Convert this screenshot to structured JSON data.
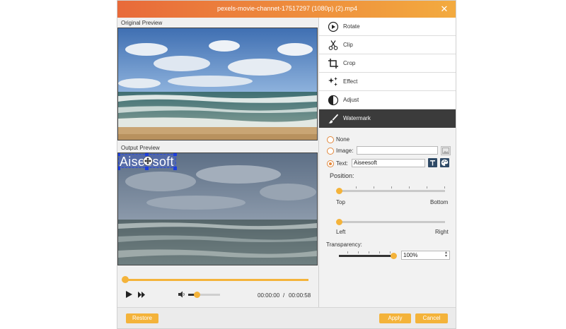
{
  "window": {
    "title": "pexels-movie-channet-17517297 (1080p) (2).mp4"
  },
  "preview": {
    "original_label": "Original Preview",
    "output_label": "Output Preview",
    "watermark_text": "Aiseesoft"
  },
  "player": {
    "current_time": "00:00:00",
    "separator": "/",
    "total_time": "00:00:58"
  },
  "menu": {
    "items": [
      {
        "label": "Rotate",
        "icon": "rotate-icon"
      },
      {
        "label": "Clip",
        "icon": "scissors-icon"
      },
      {
        "label": "Crop",
        "icon": "crop-icon"
      },
      {
        "label": "Effect",
        "icon": "sparkle-icon"
      },
      {
        "label": "Adjust",
        "icon": "adjust-icon"
      },
      {
        "label": "Watermark",
        "icon": "brush-icon"
      }
    ],
    "active": "Watermark"
  },
  "watermark": {
    "none_label": "None",
    "image_label": "Image:",
    "image_value": "",
    "text_label": "Text:",
    "text_value": "Aiseesoft",
    "selected": "text",
    "position_label": "Position:",
    "vertical": {
      "min_label": "Top",
      "max_label": "Bottom",
      "value_fraction": 0
    },
    "horizontal": {
      "min_label": "Left",
      "max_label": "Right",
      "value_fraction": 0
    },
    "transparency_label": "Transparency:",
    "transparency_value": "100%",
    "transparency_fraction": 1.0
  },
  "buttons": {
    "restore": "Restore",
    "apply": "Apply",
    "cancel": "Cancel"
  },
  "colors": {
    "accent": "#f4b33a",
    "title_start": "#e86a3a",
    "title_end": "#f3ab3f",
    "active_menu": "#3b3b3b"
  }
}
